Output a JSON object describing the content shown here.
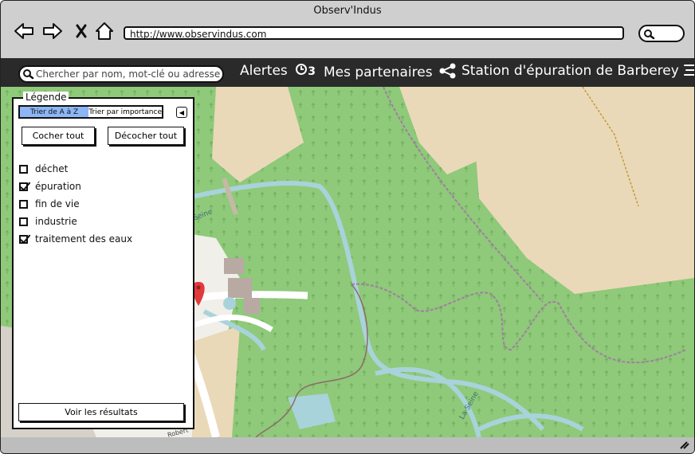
{
  "window": {
    "title": "Observ'Indus"
  },
  "browser": {
    "url": "http://www.observindus.com"
  },
  "appbar": {
    "search_placeholder": "Chercher par nom, mot-clé ou adresse",
    "alerts_label": "Alertes",
    "alerts_count": "3",
    "partners_label": "Mes partenaires",
    "station_label": "Station d'épuration de Barberey"
  },
  "legend": {
    "title": "Légende",
    "sort_alpha": "Trier de A à Z",
    "sort_importance": "Trier par importance",
    "check_all": "Cocher tout",
    "uncheck_all": "Décocher tout",
    "items": [
      {
        "label": "déchet",
        "checked": false
      },
      {
        "label": "épuration",
        "checked": true
      },
      {
        "label": "fin de vie",
        "checked": false
      },
      {
        "label": "industrie",
        "checked": false
      },
      {
        "label": "traitement des eaux",
        "checked": true
      }
    ],
    "results_button": "Voir les résultats"
  },
  "map": {
    "labels": {
      "river_1": "La Seine",
      "river_2": "La Seine",
      "street": "Robert"
    },
    "colors": {
      "forest": "#8fc97a",
      "field": "#ead9b8",
      "water": "#a8d3da",
      "road": "#ffffff",
      "marker": "#e2393b"
    }
  }
}
